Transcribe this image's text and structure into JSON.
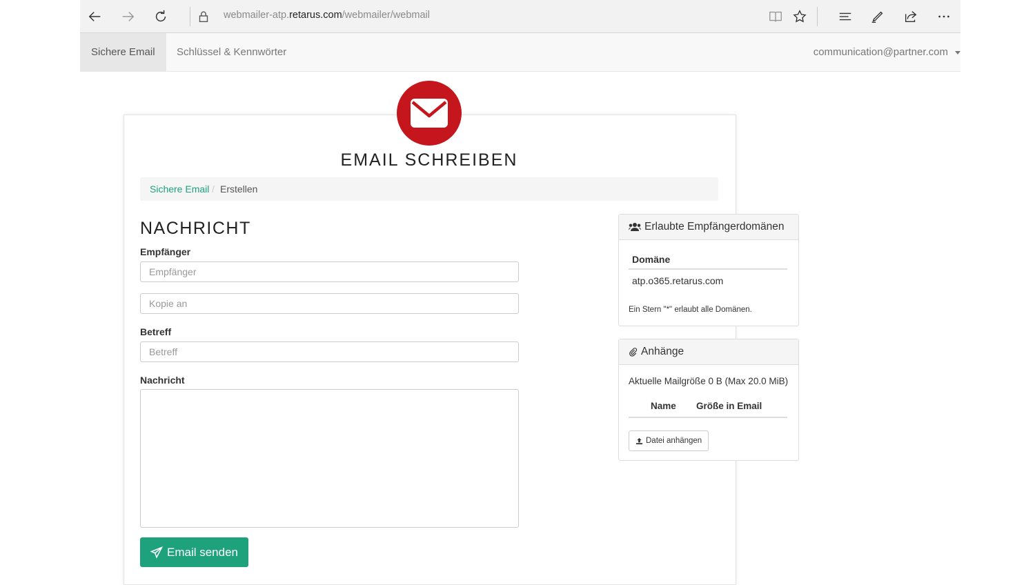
{
  "browser": {
    "url_prefix": "webmailer-atp.",
    "url_domain": "retarus.com",
    "url_path": "/webmailer/webmail"
  },
  "nav": {
    "items": [
      {
        "label": "Sichere Email"
      },
      {
        "label": "Schlüssel & Kennwörter"
      }
    ],
    "user": "communication@partner.com"
  },
  "page": {
    "title": "EMAIL SCHREIBEN",
    "breadcrumb": [
      "Sichere Email",
      "Erstellen"
    ]
  },
  "form": {
    "section_title": "NACHRICHT",
    "recipient_label": "Empfänger",
    "recipient_placeholder": "Empfänger",
    "cc_placeholder": "Kopie an",
    "subject_label": "Betreff",
    "subject_placeholder": "Betreff",
    "message_label": "Nachricht",
    "send_label": "Email senden"
  },
  "domains_panel": {
    "title": "Erlaubte Empfängerdomänen",
    "column": "Domäne",
    "rows": [
      "atp.o365.retarus.com"
    ],
    "note": "Ein Stern \"*\" erlaubt alle Domänen."
  },
  "attachments_panel": {
    "title": "Anhänge",
    "size_info": "Aktuelle Mailgröße 0 B (Max 20.0 MiB)",
    "col_name": "Name",
    "col_size": "Größe in Email",
    "attach_button": "Datei anhängen"
  },
  "colors": {
    "accent": "#1ea27c",
    "logo": "#c4161c"
  },
  "icons": [
    "back-arrow-icon",
    "forward-arrow-icon",
    "refresh-icon",
    "lock-icon",
    "reading-view-icon",
    "star-icon",
    "hub-icon",
    "pen-icon",
    "share-icon",
    "more-icon",
    "envelope-icon",
    "users-icon",
    "paperclip-icon",
    "upload-icon",
    "paper-plane-icon"
  ]
}
